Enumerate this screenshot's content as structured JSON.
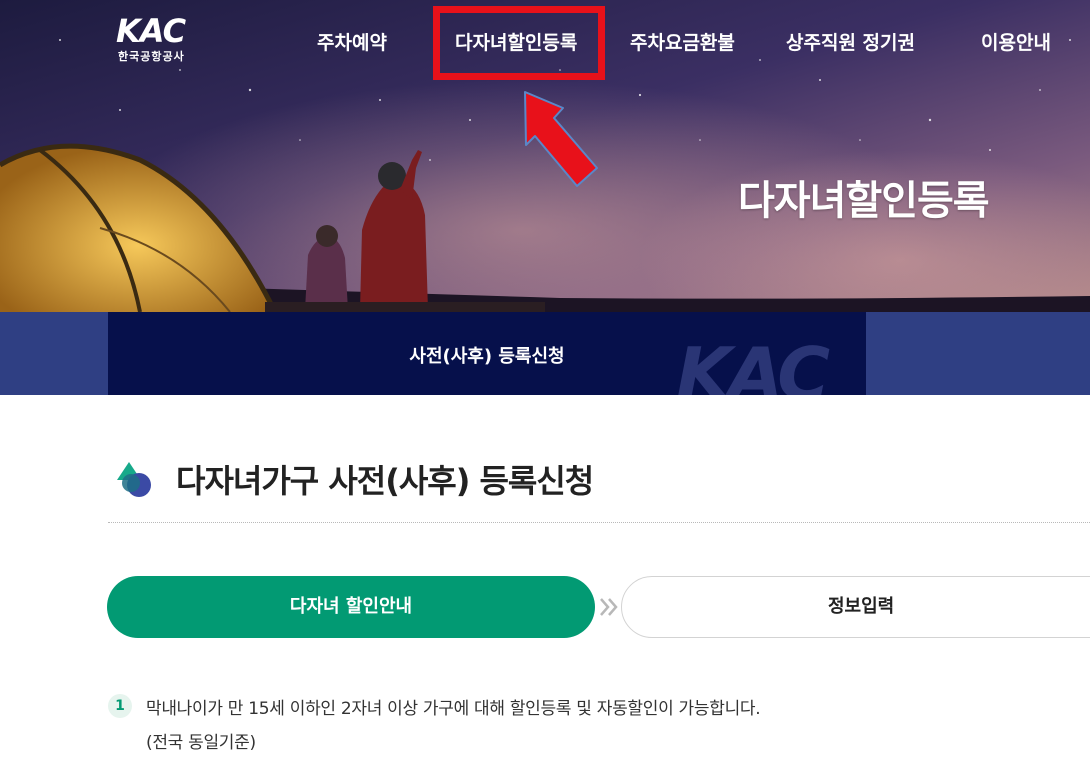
{
  "header": {
    "logo_text": "KAC",
    "logo_subtitle": "한국공항공사",
    "nav": [
      {
        "label": "주차예약"
      },
      {
        "label": "다자녀할인등록"
      },
      {
        "label": "주차요금환불"
      },
      {
        "label": "상주직원 정기권"
      },
      {
        "label": "이용안내"
      }
    ]
  },
  "hero": {
    "title": "다자녀할인등록"
  },
  "subbar": {
    "label": "사전(사후) 등록신청",
    "watermark": "KAC"
  },
  "main": {
    "heading": "다자녀가구 사전(사후) 등록신청",
    "steps": [
      {
        "label": "다자녀 할인안내",
        "active": true
      },
      {
        "label": "정보입력",
        "active": false
      }
    ],
    "notes": [
      {
        "number": "1",
        "line1": "막내나이가 만 15세 이하인 2자녀 이상 가구에 대해 할인등록 및 자동할인이 가능합니다.",
        "line2": "(전국 동일기준)"
      }
    ]
  },
  "colors": {
    "accent_green": "#029a73",
    "navy": "#06104b",
    "navy_bar": "#2f3f83",
    "highlight_red": "#e8111a"
  }
}
